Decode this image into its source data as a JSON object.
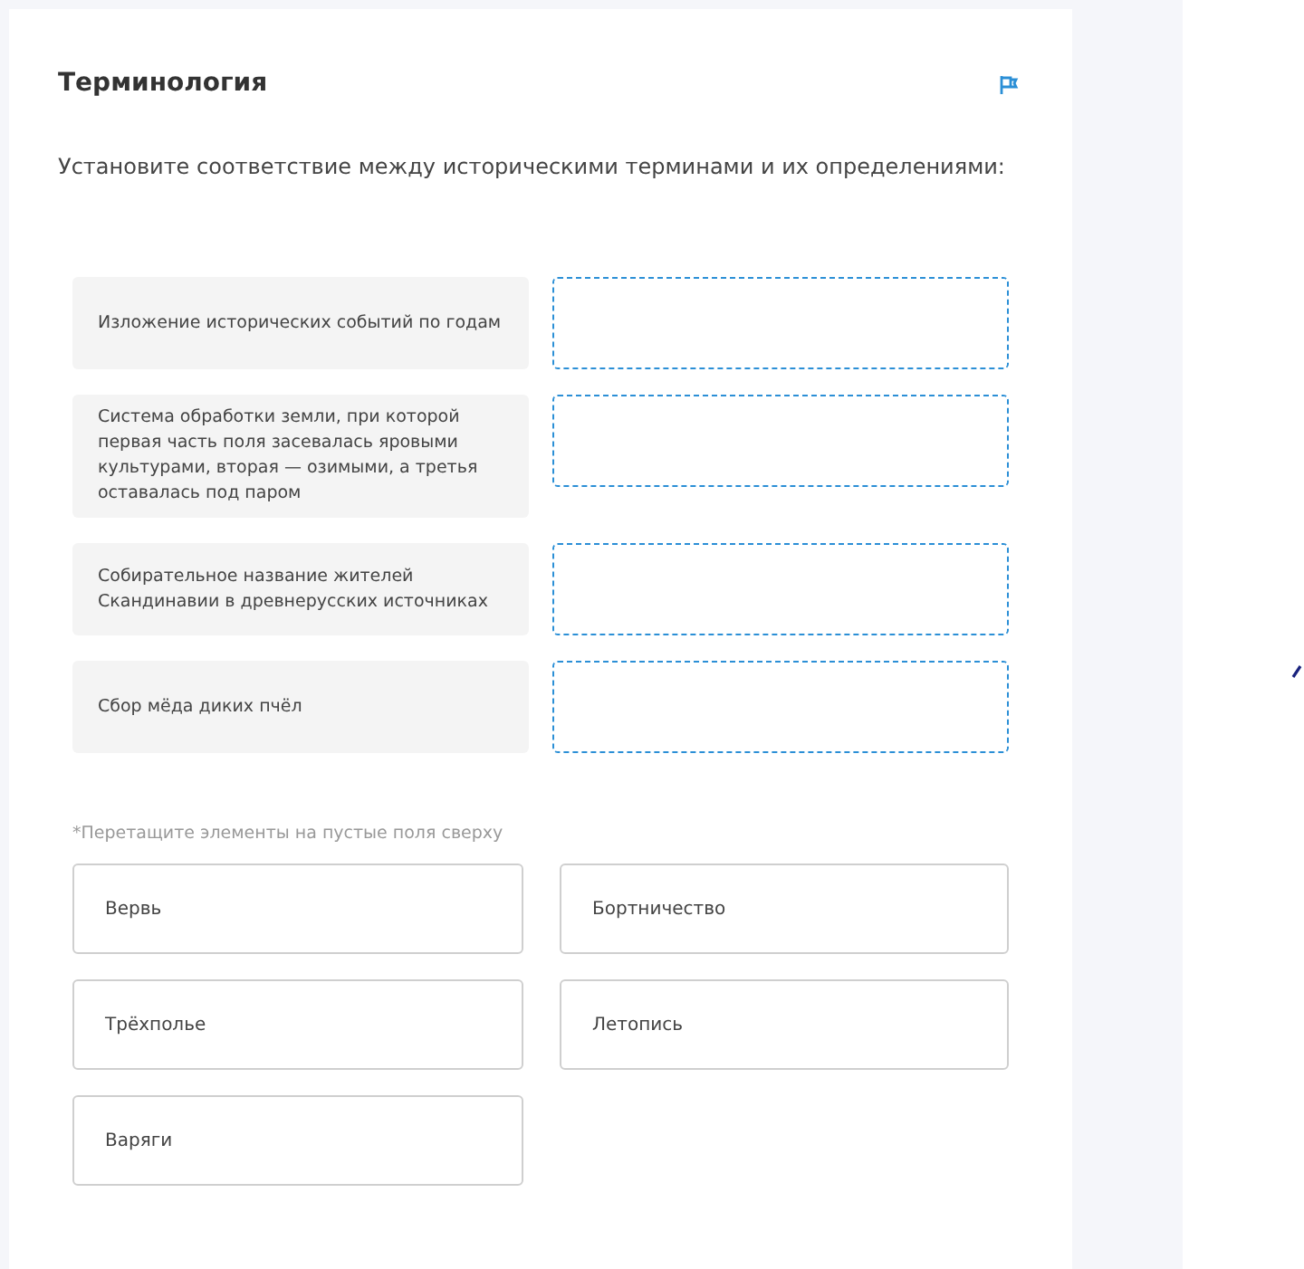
{
  "title": "Терминология",
  "instruction": "Установите соответствие между историческими терминами и их определениями:",
  "definitions": [
    {
      "text": "Изложение исторических событий по годам"
    },
    {
      "text": "Система обработки земли, при которой первая часть поля засевалась яровыми культурами, вторая — озимыми, а третья оставалась под паром"
    },
    {
      "text": "Собирательное название жителей Скандинавии в древнерусских источниках"
    },
    {
      "text": "Сбор мёда диких пчёл"
    }
  ],
  "hint": "*Перетащите элементы на пустые поля сверху",
  "options": [
    "Вервь",
    "Бортничество",
    "Трёхполье",
    "Летопись",
    "Варяги"
  ]
}
